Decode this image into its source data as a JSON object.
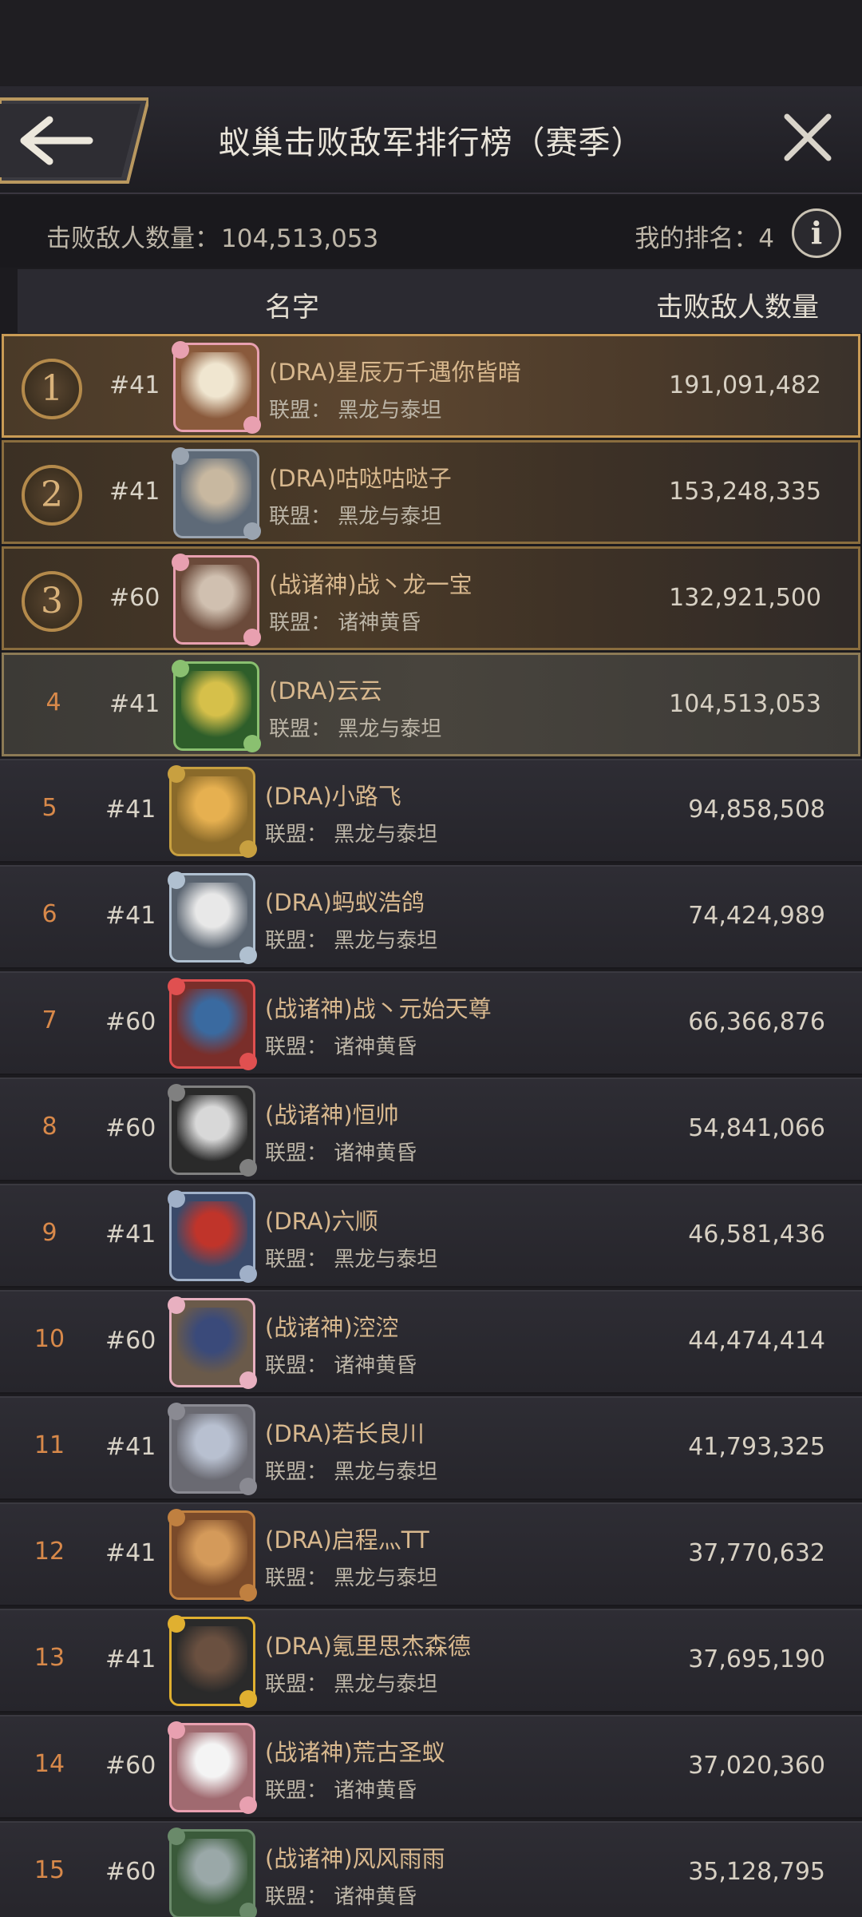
{
  "header": {
    "title": "蚁巢击败敌军排行榜（赛季）"
  },
  "info": {
    "kill_label": "击败敌人数量：",
    "kill_value": "104,513,053",
    "rank_label": "我的排名：",
    "rank_value": "4",
    "info_glyph": "i"
  },
  "columns": {
    "name": "名字",
    "kills": "击败敌人数量"
  },
  "icons": {
    "back": "back-arrow-icon",
    "close": "close-icon",
    "info": "info-icon"
  },
  "colors": {
    "accent_gold": "#c99b55",
    "rank_orange": "#d8894a",
    "name_tan": "#d8b88e"
  },
  "rows": [
    {
      "rank": "1",
      "server": "#41",
      "name": "(DRA)星辰万千遇你皆暗",
      "alliance": "联盟：  黑龙与泰坦",
      "kills": "191,091,482"
    },
    {
      "rank": "2",
      "server": "#41",
      "name": "(DRA)咕哒咕哒子",
      "alliance": "联盟：  黑龙与泰坦",
      "kills": "153,248,335"
    },
    {
      "rank": "3",
      "server": "#60",
      "name": "(战诸神)战丶龙一宝",
      "alliance": "联盟：  诸神黄昏",
      "kills": "132,921,500"
    },
    {
      "rank": "4",
      "server": "#41",
      "name": "(DRA)云云",
      "alliance": "联盟：  黑龙与泰坦",
      "kills": "104,513,053"
    },
    {
      "rank": "5",
      "server": "#41",
      "name": "(DRA)小路飞",
      "alliance": "联盟：  黑龙与泰坦",
      "kills": "94,858,508"
    },
    {
      "rank": "6",
      "server": "#41",
      "name": "(DRA)蚂蚁浩鸽",
      "alliance": "联盟：  黑龙与泰坦",
      "kills": "74,424,989"
    },
    {
      "rank": "7",
      "server": "#60",
      "name": "(战诸神)战丶元始天尊",
      "alliance": "联盟：  诸神黄昏",
      "kills": "66,366,876"
    },
    {
      "rank": "8",
      "server": "#60",
      "name": "(战诸神)恒帅",
      "alliance": "联盟：  诸神黄昏",
      "kills": "54,841,066"
    },
    {
      "rank": "9",
      "server": "#41",
      "name": "(DRA)六顺",
      "alliance": "联盟：  黑龙与泰坦",
      "kills": "46,581,436"
    },
    {
      "rank": "10",
      "server": "#60",
      "name": "(战诸神)涳涳",
      "alliance": "联盟：  诸神黄昏",
      "kills": "44,474,414"
    },
    {
      "rank": "11",
      "server": "#41",
      "name": "(DRA)若长良川",
      "alliance": "联盟：  黑龙与泰坦",
      "kills": "41,793,325"
    },
    {
      "rank": "12",
      "server": "#41",
      "name": "(DRA)启程灬TT",
      "alliance": "联盟：  黑龙与泰坦",
      "kills": "37,770,632"
    },
    {
      "rank": "13",
      "server": "#41",
      "name": "(DRA)氪里思杰森德",
      "alliance": "联盟：  黑龙与泰坦",
      "kills": "37,695,190"
    },
    {
      "rank": "14",
      "server": "#60",
      "name": "(战诸神)荒古圣蚁",
      "alliance": "联盟：  诸神黄昏",
      "kills": "37,020,360"
    },
    {
      "rank": "15",
      "server": "#60",
      "name": "(战诸神)风风雨雨",
      "alliance": "联盟：  诸神黄昏",
      "kills": "35,128,795"
    }
  ]
}
